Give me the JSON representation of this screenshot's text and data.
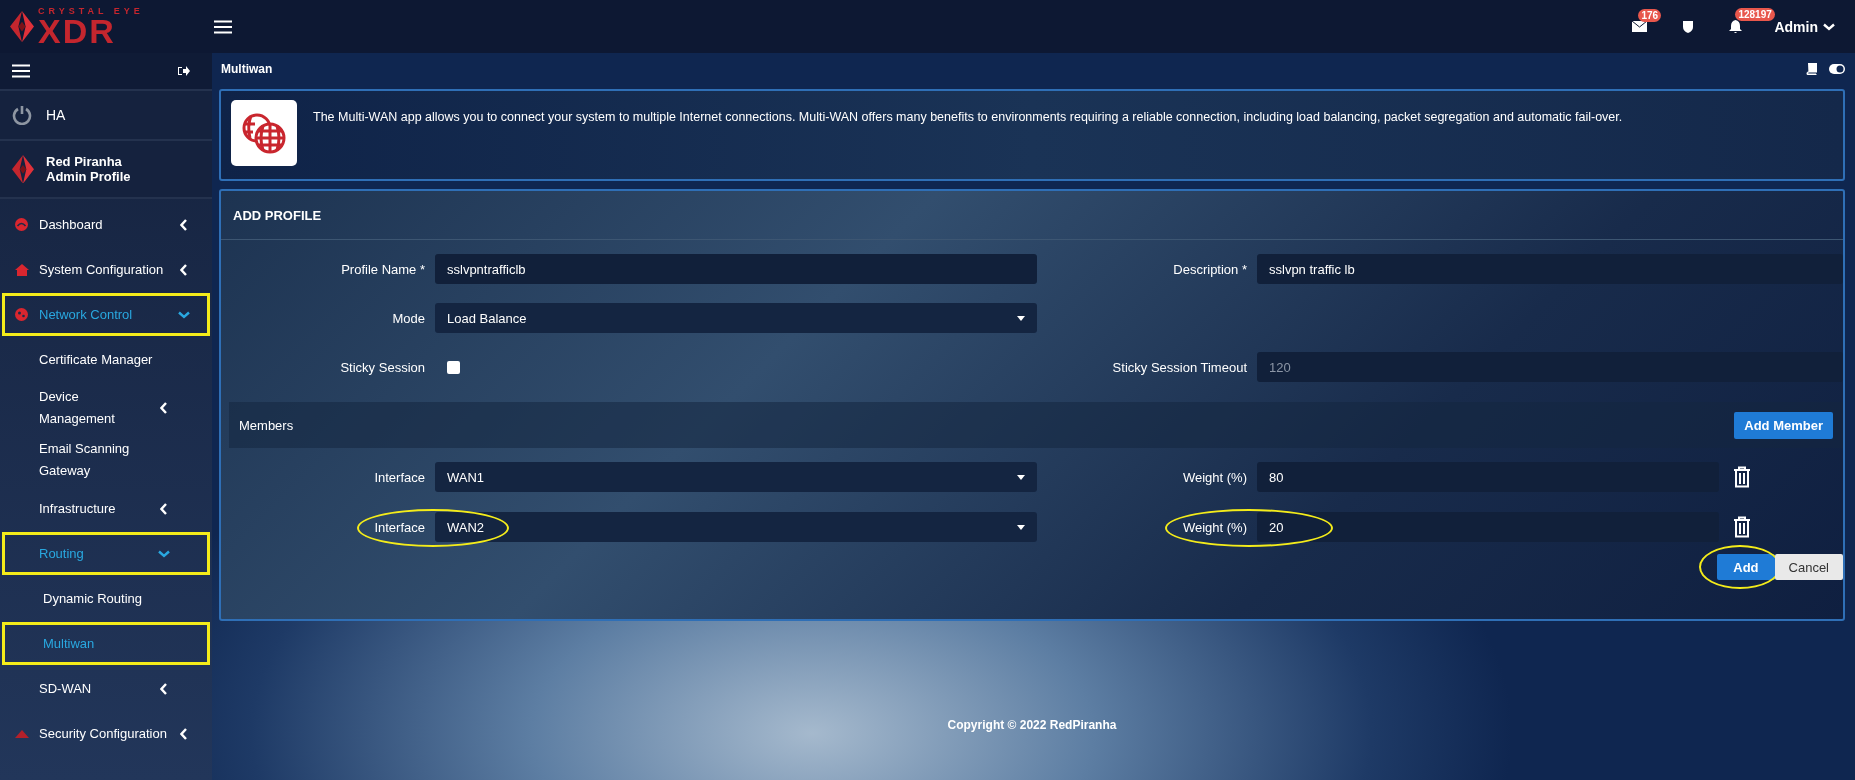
{
  "header": {
    "logo_top": "CRYSTAL EYE",
    "logo_main": "XDR",
    "mail_count": "176",
    "alert_count": "128197",
    "user": "Admin"
  },
  "sidebar": {
    "ha_label": "HA",
    "profile_name": "Red Piranha",
    "profile_role": "Admin Profile",
    "items": [
      {
        "label": "Dashboard",
        "expandable": true,
        "expanded": false,
        "selected": false,
        "highlighted": false
      },
      {
        "label": "System Configuration",
        "expandable": true,
        "expanded": false,
        "selected": false,
        "highlighted": false
      },
      {
        "label": "Network Control",
        "expandable": true,
        "expanded": true,
        "selected": true,
        "highlighted": true,
        "children": [
          {
            "label": "Certificate Manager",
            "expandable": false,
            "selected": false,
            "highlighted": false
          },
          {
            "label": "Device Management",
            "expandable": true,
            "expanded": false,
            "selected": false,
            "highlighted": false
          },
          {
            "label": "Email Scanning Gateway",
            "expandable": false,
            "selected": false,
            "highlighted": false
          },
          {
            "label": "Infrastructure",
            "expandable": true,
            "expanded": false,
            "selected": false,
            "highlighted": false
          },
          {
            "label": "Routing",
            "expandable": true,
            "expanded": true,
            "selected": true,
            "highlighted": true,
            "children": [
              {
                "label": "Dynamic Routing",
                "expandable": false,
                "selected": false,
                "highlighted": false
              },
              {
                "label": "Multiwan",
                "expandable": false,
                "selected": true,
                "highlighted": true
              }
            ]
          },
          {
            "label": "SD-WAN",
            "expandable": true,
            "expanded": false,
            "selected": false,
            "highlighted": false
          }
        ]
      },
      {
        "label": "Security Configuration",
        "expandable": true,
        "expanded": false,
        "selected": false,
        "highlighted": false
      }
    ]
  },
  "page": {
    "title": "Multiwan",
    "info_text": "The Multi-WAN app allows you to connect your system to multiple Internet connections. Multi-WAN offers many benefits to environments requiring a reliable connection, including load balancing, packet segregation and automatic fail-over.",
    "form": {
      "title": "ADD PROFILE",
      "profile_name": {
        "label": "Profile Name *",
        "value": "sslvpntrafficlb"
      },
      "description": {
        "label": "Description *",
        "value": "sslvpn traffic lb"
      },
      "mode": {
        "label": "Mode",
        "value": "Load Balance"
      },
      "sticky_session": {
        "label": "Sticky Session",
        "checked": false
      },
      "sticky_timeout": {
        "label": "Sticky Session Timeout",
        "placeholder": "120"
      },
      "members": {
        "title": "Members",
        "add_button": "Add Member",
        "rows": [
          {
            "interface_label": "Interface",
            "interface": "WAN1",
            "weight_label": "Weight (%)",
            "weight": "80"
          },
          {
            "interface_label": "Interface",
            "interface": "WAN2",
            "weight_label": "Weight (%)",
            "weight": "20",
            "circled": true
          }
        ]
      },
      "buttons": [
        {
          "label": "Add",
          "kind": "primary",
          "circled": true
        },
        {
          "label": "Cancel",
          "kind": "secondary"
        }
      ]
    }
  },
  "footer": {
    "copyright": "Copyright © 2022 RedPiranha"
  }
}
